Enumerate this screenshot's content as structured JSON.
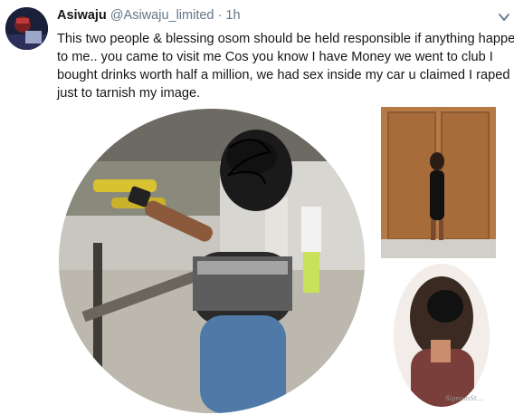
{
  "tweet": {
    "display_name": "Asiwaju",
    "handle": "@Asiwaju_limited",
    "separator": "·",
    "time": "1h",
    "text_lines": [
      "This two people & blessing osom should be held responsible if anything happen",
      "to me.. you came to visit me Cos you know I have Money we went to club  I",
      "bought drinks worth half a million, we had sex inside my car u claimed I raped u",
      "just to tarnish my image."
    ]
  },
  "icons": {
    "avatar": "user-avatar",
    "caret": "chevron-down-icon"
  },
  "media": {
    "watermark": "SignumSt..."
  },
  "colors": {
    "text": "#14171a",
    "secondary": "#657786",
    "background": "#ffffff"
  }
}
